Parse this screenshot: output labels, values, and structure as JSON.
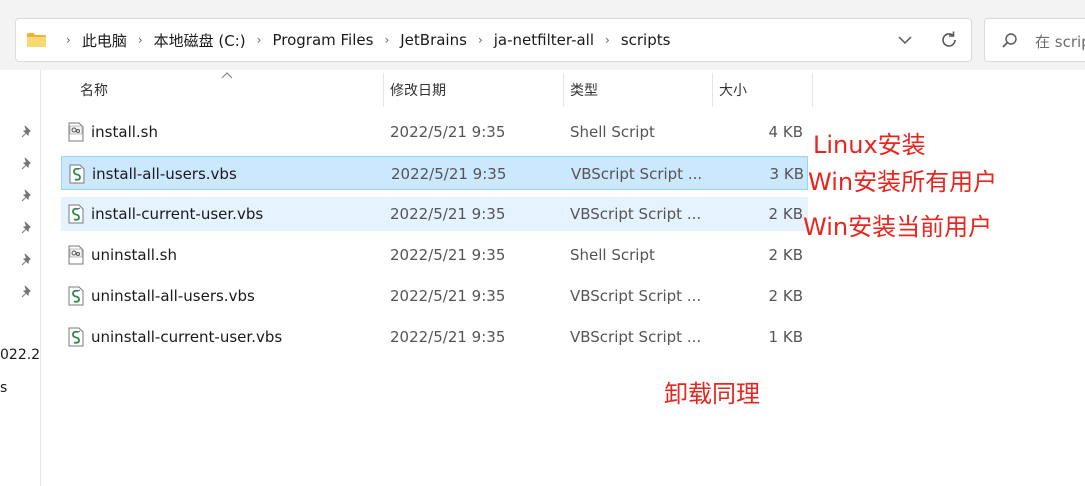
{
  "address_bar": {
    "breadcrumbs": [
      "此电脑",
      "本地磁盘 (C:)",
      "Program Files",
      "JetBrains",
      "ja-netfilter-all",
      "scripts"
    ]
  },
  "search": {
    "placeholder": "在 scrip"
  },
  "columns": {
    "name": "名称",
    "date": "修改日期",
    "type": "类型",
    "size": "大小"
  },
  "files": [
    {
      "name": "install.sh",
      "date": "2022/5/21 9:35",
      "type": "Shell Script",
      "size": "4 KB",
      "icon": "shell-script-icon",
      "state": "normal"
    },
    {
      "name": "install-all-users.vbs",
      "date": "2022/5/21 9:35",
      "type": "VBScript Script ...",
      "size": "3 KB",
      "icon": "vbscript-icon",
      "state": "selected"
    },
    {
      "name": "install-current-user.vbs",
      "date": "2022/5/21 9:35",
      "type": "VBScript Script ...",
      "size": "2 KB",
      "icon": "vbscript-icon",
      "state": "hover"
    },
    {
      "name": "uninstall.sh",
      "date": "2022/5/21 9:35",
      "type": "Shell Script",
      "size": "2 KB",
      "icon": "shell-script-icon",
      "state": "normal"
    },
    {
      "name": "uninstall-all-users.vbs",
      "date": "2022/5/21 9:35",
      "type": "VBScript Script ...",
      "size": "2 KB",
      "icon": "vbscript-icon",
      "state": "normal"
    },
    {
      "name": "uninstall-current-user.vbs",
      "date": "2022/5/21 9:35",
      "type": "VBScript Script ...",
      "size": "1 KB",
      "icon": "vbscript-icon",
      "state": "normal"
    }
  ],
  "left_panel": {
    "partial_text_1": "022.2",
    "partial_text_2": "s"
  },
  "annotations": {
    "linux_install": "Linux安装",
    "win_install_all": "Win安装所有用户",
    "win_install_current": "Win安装当前用户",
    "uninstall_same": "卸载同理"
  },
  "colors": {
    "annotation": "#e8261f",
    "selected_row": "#cce8ff",
    "hover_row": "#e5f3ff"
  }
}
